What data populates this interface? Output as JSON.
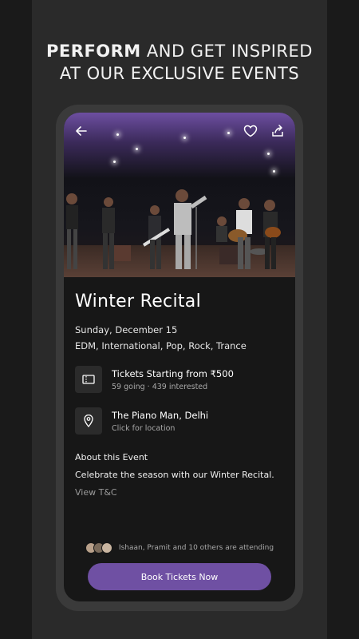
{
  "headline": {
    "bold": "PERFORM",
    "rest_line1": " AND GET INSPIRED",
    "line2": "AT OUR EXCLUSIVE EVENTS"
  },
  "top_bar": {
    "back_icon": "arrow-left-icon",
    "favorite_icon": "heart-icon",
    "share_icon": "share-icon"
  },
  "event": {
    "title": "Winter Recital",
    "date": "Sunday, December 15",
    "genres": "EDM, International, Pop, Rock, Trance"
  },
  "tickets": {
    "icon": "ticket-icon",
    "label": "Tickets Starting from ₹500",
    "stats": "59 going · 439 interested"
  },
  "venue": {
    "icon": "location-pin-icon",
    "name": "The Piano Man, Delhi",
    "hint": "Click for location"
  },
  "about": {
    "title": "About this Event",
    "description": "Celebrate the season with our Winter Recital.",
    "tandc": "View T&C"
  },
  "attending": {
    "text": "Ishaan, Pramit and 10 others are attending"
  },
  "cta": {
    "label": "Book Tickets Now"
  },
  "colors": {
    "accent": "#6f50a3",
    "background": "#171717",
    "frame": "#3a3a3a"
  }
}
